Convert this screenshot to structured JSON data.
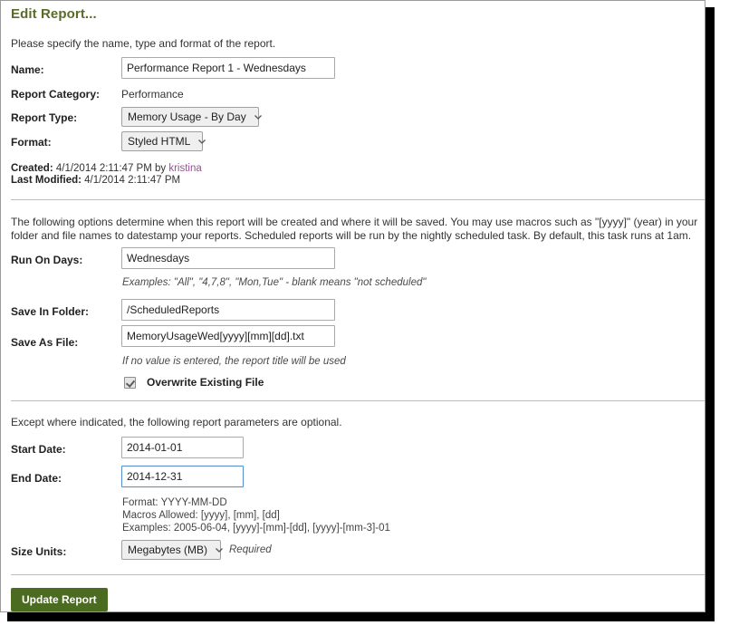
{
  "window": {
    "title": "Edit Report..."
  },
  "section_top": {
    "intro": "Please specify the name, type and format of the report.",
    "name_label": "Name:",
    "name_value": "Performance Report 1 - Wednesdays",
    "category_label": "Report Category:",
    "category_value": "Performance",
    "report_type_label": "Report Type:",
    "report_type_value": "Memory Usage - By Day",
    "format_label": "Format:",
    "format_value": "Styled HTML"
  },
  "meta": {
    "created_label": "Created:",
    "created_value": "4/1/2014 2:11:47 PM",
    "created_by_prefix": "by",
    "created_by_user": "kristina",
    "modified_label": "Last Modified:",
    "modified_value": "4/1/2014 2:11:47 PM"
  },
  "section_schedule": {
    "intro": "The following options determine when this report will be created and where it will be saved. You may use macros such as \"[yyyy]\" (year) in your folder and file names to datestamp your reports. Scheduled reports will be run by the nightly scheduled task. By default, this task runs at 1am.",
    "run_on_days_label": "Run On Days:",
    "run_on_days_value": "Wednesdays",
    "run_on_days_hint": "Examples: \"All\", \"4,7,8\", \"Mon,Tue\" - blank means \"not scheduled\"",
    "save_in_folder_label": "Save In Folder:",
    "save_in_folder_value": "/ScheduledReports",
    "save_as_file_label": "Save As File:",
    "save_as_file_value": "MemoryUsageWed[yyyy][mm][dd].txt",
    "save_as_file_hint": "If no value is entered, the report title will be used",
    "overwrite_label": "Overwrite Existing File",
    "overwrite_checked": true
  },
  "section_params": {
    "intro": "Except where indicated, the following report parameters are optional.",
    "start_date_label": "Start Date:",
    "start_date_value": "2014-01-01",
    "end_date_label": "End Date:",
    "end_date_value": "2014-12-31",
    "date_hint_1": "Format: YYYY-MM-DD",
    "date_hint_2": "Macros Allowed: [yyyy], [mm], [dd]",
    "date_hint_3": "Examples: 2005-06-04, [yyyy]-[mm]-[dd], [yyyy]-[mm-3]-01",
    "size_units_label": "Size Units:",
    "size_units_value": "Megabytes (MB)",
    "size_units_required": "Required"
  },
  "footer": {
    "submit_label": "Update Report"
  },
  "colors": {
    "title": "#5a6b27",
    "button_bg": "#4b6b20",
    "link": "#9b4a9b",
    "focus_border": "#5a8fd0"
  }
}
